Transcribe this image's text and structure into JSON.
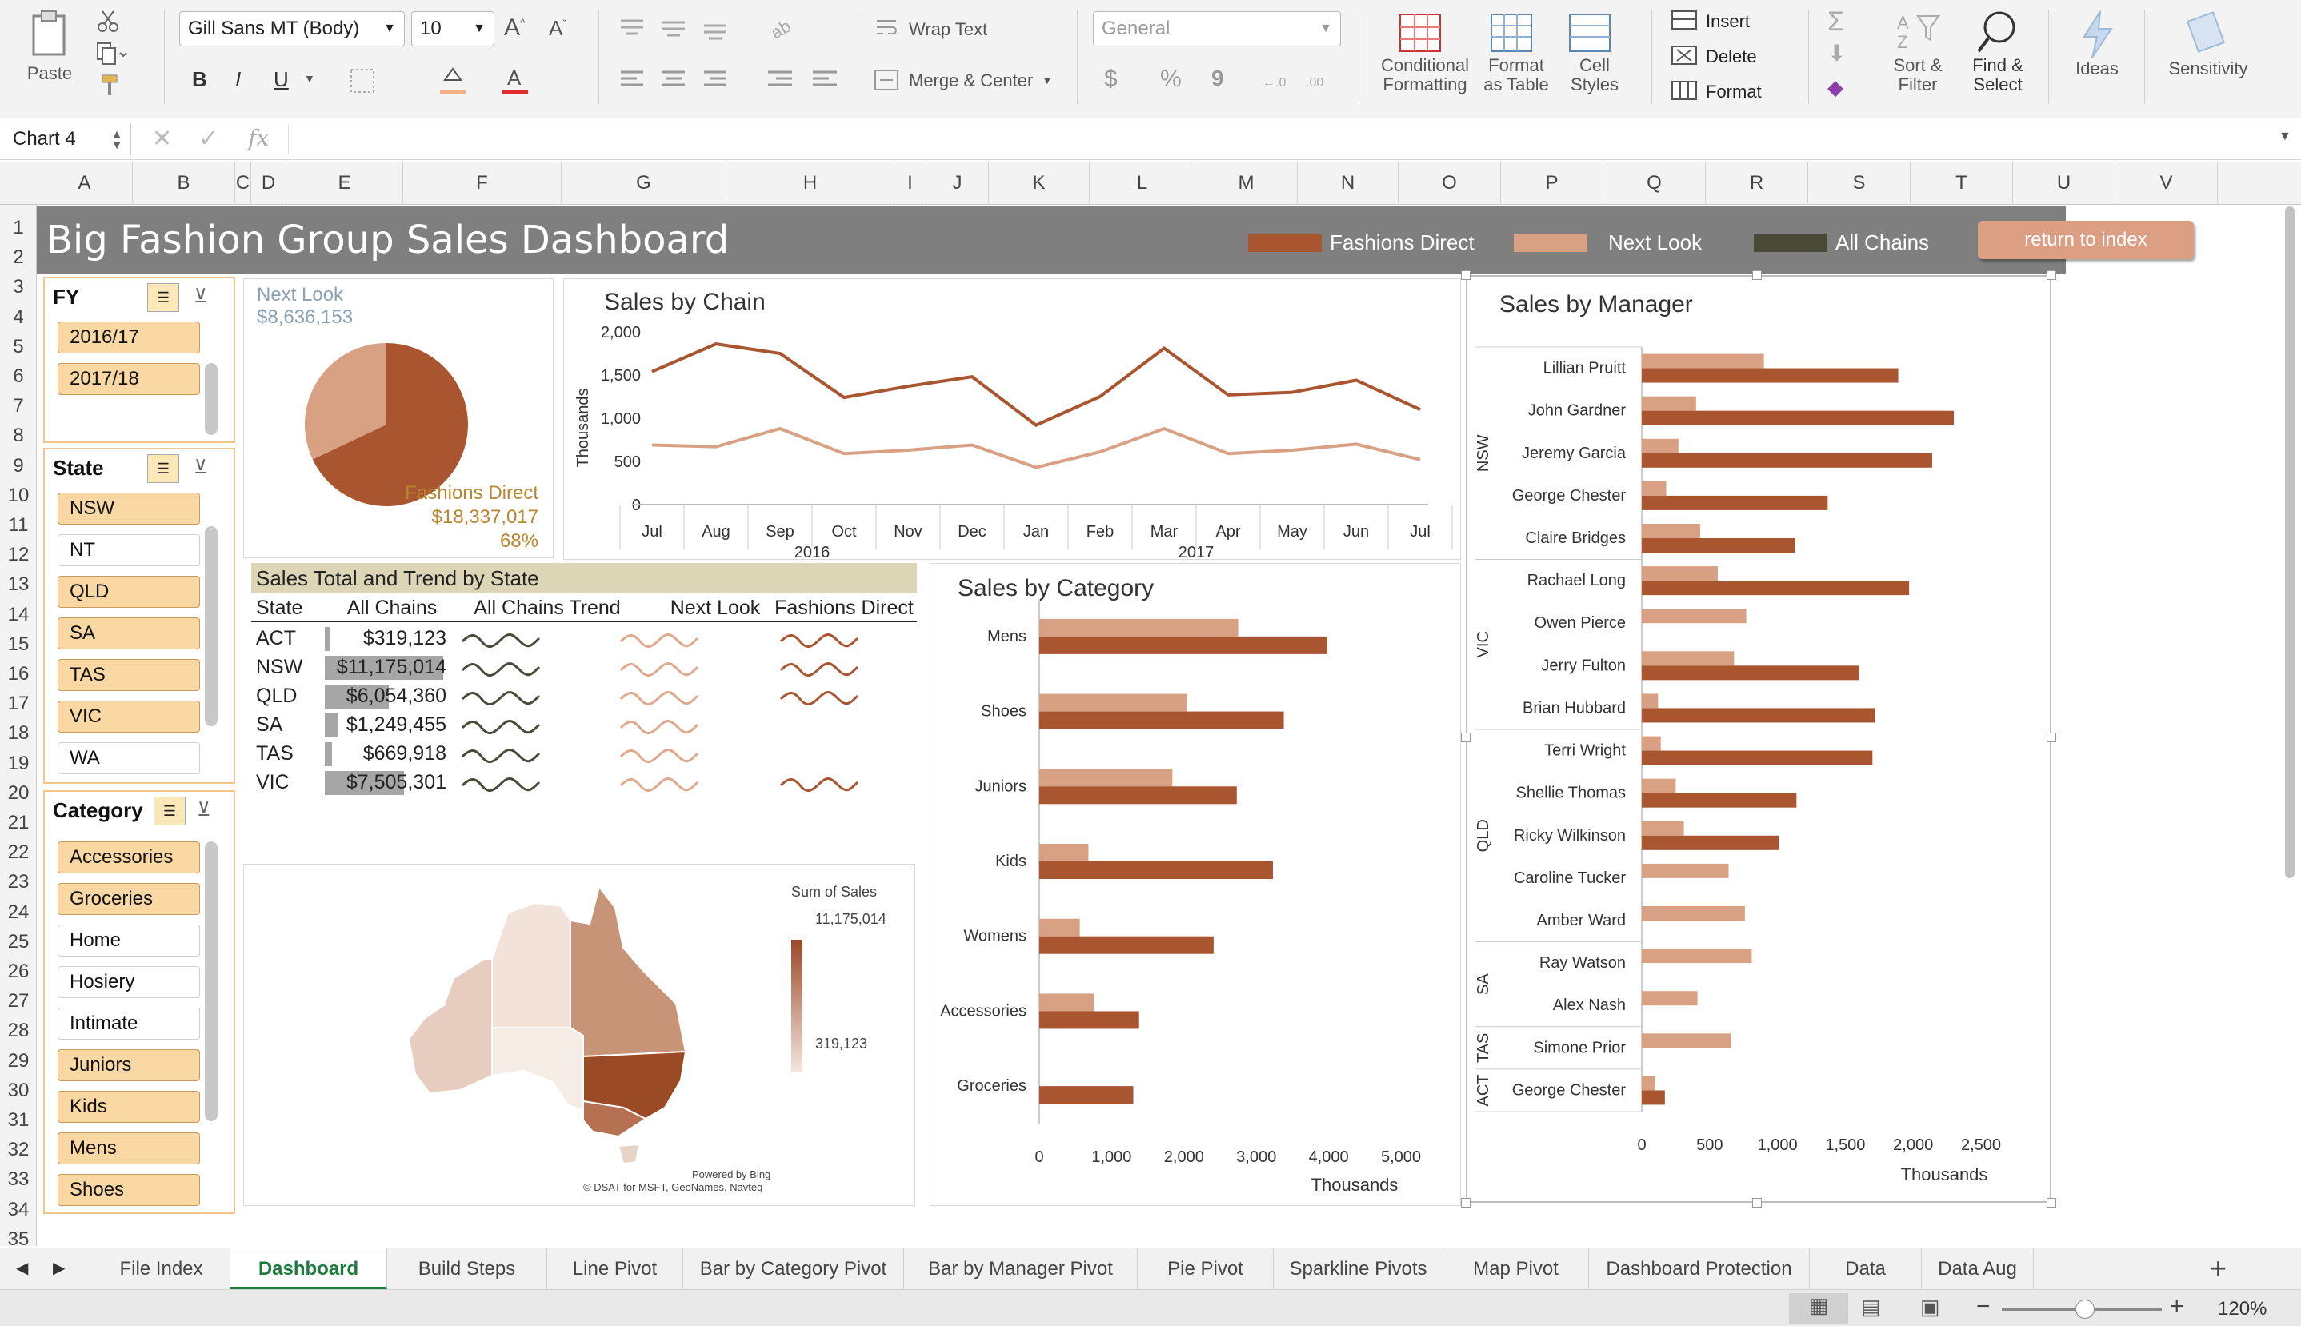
{
  "ribbon": {
    "paste": "Paste",
    "font_name": "Gill Sans MT (Body)",
    "font_size": "10",
    "bold": "B",
    "italic": "I",
    "underline": "U",
    "wrap_text": "Wrap Text",
    "merge_center": "Merge & Center",
    "number_format": "General",
    "currency": "$",
    "percent": "%",
    "comma": "9",
    "conditional_formatting": [
      "Conditional",
      "Formatting"
    ],
    "format_as_table": [
      "Format",
      "as Table"
    ],
    "cell_styles": [
      "Cell",
      "Styles"
    ],
    "insert": "Insert",
    "delete": "Delete",
    "format": "Format",
    "sort_filter": [
      "Sort &",
      "Filter"
    ],
    "find_select": [
      "Find &",
      "Select"
    ],
    "ideas": "Ideas",
    "sensitivity": "Sensitivity"
  },
  "formula_bar": {
    "name_box": "Chart 4",
    "fx": "fx"
  },
  "columns": [
    "A",
    "B",
    "C",
    "D",
    "E",
    "F",
    "G",
    "H",
    "I",
    "J",
    "K",
    "L",
    "M",
    "N",
    "O",
    "P",
    "Q",
    "R",
    "S",
    "T",
    "U",
    "V"
  ],
  "rows": [
    "1",
    "2",
    "3",
    "4",
    "5",
    "6",
    "7",
    "8",
    "9",
    "10",
    "11",
    "12",
    "13",
    "14",
    "15",
    "16",
    "17",
    "18",
    "19",
    "20",
    "21",
    "22",
    "23",
    "24",
    "25",
    "26",
    "27",
    "28",
    "29",
    "30",
    "31",
    "32",
    "33",
    "34",
    "35"
  ],
  "dashboard": {
    "title": "Big Fashion Group Sales Dashboard",
    "legend": [
      {
        "label": "Fashions Direct",
        "color": "#a9552f"
      },
      {
        "label": "Next Look",
        "color": "#d9a184"
      },
      {
        "label": "All Chains",
        "color": "#4a4a39"
      }
    ],
    "return_button": "return to index"
  },
  "slicers": {
    "fy": {
      "title": "FY",
      "items": [
        {
          "label": "2016/17",
          "selected": true
        },
        {
          "label": "2017/18",
          "selected": true
        }
      ]
    },
    "state": {
      "title": "State",
      "items": [
        {
          "label": "NSW",
          "selected": true
        },
        {
          "label": "NT",
          "selected": false
        },
        {
          "label": "QLD",
          "selected": true
        },
        {
          "label": "SA",
          "selected": true
        },
        {
          "label": "TAS",
          "selected": true
        },
        {
          "label": "VIC",
          "selected": true
        },
        {
          "label": "WA",
          "selected": false
        }
      ]
    },
    "category": {
      "title": "Category",
      "items": [
        {
          "label": "Accessories",
          "selected": true
        },
        {
          "label": "Groceries",
          "selected": true
        },
        {
          "label": "Home",
          "selected": false
        },
        {
          "label": "Hosiery",
          "selected": false
        },
        {
          "label": "Intimate",
          "selected": false
        },
        {
          "label": "Juniors",
          "selected": true
        },
        {
          "label": "Kids",
          "selected": true
        },
        {
          "label": "Mens",
          "selected": true
        },
        {
          "label": "Shoes",
          "selected": true
        }
      ]
    }
  },
  "pie": {
    "next_look_label": "Next Look",
    "next_look_value": "$8,636,153",
    "fd_label": "Fashions Direct",
    "fd_value": "$18,337,017",
    "fd_pct": "68%"
  },
  "state_table": {
    "title": "Sales Total and Trend by State",
    "headers": [
      "State",
      "All Chains",
      "All Chains Trend",
      "Next Look",
      "Fashions Direct"
    ],
    "rows": [
      {
        "state": "ACT",
        "total": "$319,123",
        "share": 0.029,
        "fd_trend": true
      },
      {
        "state": "NSW",
        "total": "$11,175,014",
        "share": 1.0,
        "fd_trend": true
      },
      {
        "state": "QLD",
        "total": "$6,054,360",
        "share": 0.54,
        "fd_trend": true
      },
      {
        "state": "SA",
        "total": "$1,249,455",
        "share": 0.112,
        "fd_trend": false
      },
      {
        "state": "TAS",
        "total": "$669,918",
        "share": 0.06,
        "fd_trend": false
      },
      {
        "state": "VIC",
        "total": "$7,505,301",
        "share": 0.672,
        "fd_trend": true
      }
    ]
  },
  "map": {
    "legend_title": "Sum of Sales",
    "legend_max": "11,175,014",
    "legend_min": "319,123",
    "credit1": "Powered by Bing",
    "credit2": "© DSAT for MSFT, GeoNames, Navteq"
  },
  "chart_data": [
    {
      "type": "line",
      "title": "Sales by Chain",
      "ylabel": "Thousands",
      "ylim": [
        0,
        2000
      ],
      "yticks": [
        "0",
        "500",
        "1,000",
        "1,500",
        "2,000"
      ],
      "categories": [
        "Jul",
        "Aug",
        "Sep",
        "Oct",
        "Nov",
        "Dec",
        "Jan",
        "Feb",
        "Mar",
        "Apr",
        "May",
        "Jun",
        "Jul"
      ],
      "year_labels": [
        "2016",
        "2017"
      ],
      "series": [
        {
          "name": "Fashions Direct",
          "color": "#a9552f",
          "values": [
            1540,
            1860,
            1750,
            1240,
            1370,
            1480,
            920,
            1250,
            1810,
            1270,
            1300,
            1440,
            1100
          ]
        },
        {
          "name": "Next Look",
          "color": "#d9a184",
          "values": [
            690,
            670,
            880,
            590,
            630,
            690,
            430,
            610,
            880,
            590,
            630,
            700,
            520
          ]
        }
      ]
    },
    {
      "type": "bar",
      "title": "Sales by Category",
      "xlabel": "Thousands",
      "xlim": [
        0,
        5000
      ],
      "xticks": [
        "0",
        "1,000",
        "2,000",
        "3,000",
        "4,000",
        "5,000"
      ],
      "categories": [
        "Mens",
        "Shoes",
        "Juniors",
        "Kids",
        "Womens",
        "Accessories",
        "Groceries"
      ],
      "series": [
        {
          "name": "Next Look",
          "color": "#d9a184",
          "values": [
            2750,
            2040,
            1840,
            680,
            560,
            760,
            0
          ]
        },
        {
          "name": "Fashions Direct",
          "color": "#a9552f",
          "values": [
            3980,
            3380,
            2730,
            3230,
            2410,
            1380,
            1300
          ]
        }
      ]
    },
    {
      "type": "bar",
      "title": "Sales by Manager",
      "xlabel": "Thousands",
      "xlim": [
        0,
        2500
      ],
      "xticks": [
        "0",
        "500",
        "1,000",
        "1,500",
        "2,000",
        "2,500"
      ],
      "groups": [
        {
          "label": "NSW",
          "count": 5
        },
        {
          "label": "VIC",
          "count": 4
        },
        {
          "label": "QLD",
          "count": 5
        },
        {
          "label": "SA",
          "count": 2
        },
        {
          "label": "TAS",
          "count": 1
        },
        {
          "label": "ACT",
          "count": 1
        }
      ],
      "categories": [
        "Lillian Pruitt",
        "John Gardner",
        "Jeremy Garcia",
        "George Chester",
        "Claire Bridges",
        "Rachael Long",
        "Owen Pierce",
        "Jerry Fulton",
        "Brian Hubbard",
        "Terri Wright",
        "Shellie Thomas",
        "Ricky Wilkinson",
        "Caroline Tucker",
        "Amber Ward",
        "Ray Watson",
        "Alex Nash",
        "Simone Prior",
        "George Chester"
      ],
      "series": [
        {
          "name": "Next Look",
          "color": "#d9a184",
          "values": [
            900,
            400,
            270,
            180,
            430,
            560,
            770,
            680,
            120,
            140,
            250,
            310,
            640,
            760,
            810,
            410,
            660,
            100
          ]
        },
        {
          "name": "Fashions Direct",
          "color": "#a9552f",
          "values": [
            1890,
            2300,
            2140,
            1370,
            1130,
            1970,
            0,
            1600,
            1720,
            1700,
            1140,
            1010,
            0,
            0,
            0,
            0,
            0,
            170
          ]
        }
      ]
    },
    {
      "type": "pie",
      "series": [
        {
          "name": "Fashions Direct",
          "value": 18337017,
          "color": "#a9552f"
        },
        {
          "name": "Next Look",
          "value": 8636153,
          "color": "#d9a184"
        }
      ]
    }
  ],
  "sheet_tabs": [
    {
      "label": "File Index",
      "active": false
    },
    {
      "label": "Dashboard",
      "active": true
    },
    {
      "label": "Build Steps",
      "active": false
    },
    {
      "label": "Line Pivot",
      "active": false
    },
    {
      "label": "Bar by Category Pivot",
      "active": false
    },
    {
      "label": "Bar by Manager Pivot",
      "active": false
    },
    {
      "label": "Pie Pivot",
      "active": false
    },
    {
      "label": "Sparkline Pivots",
      "active": false
    },
    {
      "label": "Map Pivot",
      "active": false
    },
    {
      "label": "Dashboard Protection",
      "active": false
    },
    {
      "label": "Data",
      "active": false
    },
    {
      "label": "Data Aug",
      "active": false
    }
  ],
  "status": {
    "zoom": "120%"
  }
}
